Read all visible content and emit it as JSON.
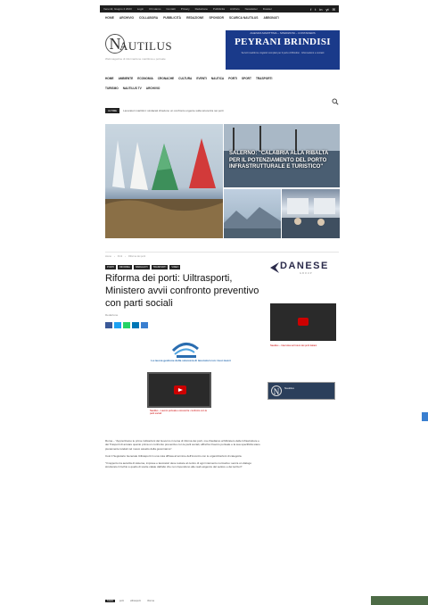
{
  "topbar": {
    "items": [
      "Venerdì, Giugno 2 2023",
      "Login",
      "Chi siamo",
      "Contatti",
      "Privacy",
      "Redazione",
      "Pubblicità",
      "Archivio",
      "Newsletter",
      "Dossier"
    ],
    "social": [
      "f",
      "t",
      "in",
      "yt",
      "✉"
    ]
  },
  "submenu": [
    "HOME",
    "ARCHIVIO",
    "COLLABORA",
    "PUBBLICITÀ",
    "REDAZIONE",
    "SPONSOR",
    "SCARICA NAUTILUS",
    "ABBONATI"
  ],
  "logo": {
    "word": "AUTILUS",
    "letter": "N",
    "tagline": "Webmagazine di informazione marittima e portuale"
  },
  "ad": {
    "top": "AGENZIA MARITTIMA – SPEDIZIONI – CONTAINERS",
    "main": "PEYRANI BRINDISI",
    "sub": "Servizi marittimi e logistici completi per il porto di Brindisi · Informazioni e contatti"
  },
  "mainnav": [
    "HOME",
    "AMBIENTE",
    "ECONOMIA",
    "CRONACHE",
    "CULTURA",
    "EVENTI",
    "NAUTICA",
    "PORTI",
    "SPORT",
    "TRASPORTI"
  ],
  "mainnav2": [
    "TURISMO",
    "NAUTILUS TV",
    "ARCHIVIO"
  ],
  "ticker": {
    "badge": "ULTIME",
    "text": "Lavoratori marittimi: sindacati chiedono un confronto urgente sulla sicurezza nei porti"
  },
  "hero": {
    "overlay": "Salerno: \"Calabria alla ribalta per il potenziamento del porto infrastrutturale e turistico\""
  },
  "crumbs": [
    "Home",
    "›",
    "Porti",
    "›",
    "Riforma dei porti"
  ],
  "categories": [
    "PORTI",
    "RIFORMA",
    "SINDACATI",
    "TRASPORTI",
    "VIDEO"
  ],
  "article": {
    "title": "Riforma dei porti: Uiltrasporti, Ministero avvii confronto preventivo con parti sociali",
    "author": "Redazione",
    "date": "",
    "brand_caption": "La nuova gestione della sicurezza di lavoratori con i tuoi mezzi",
    "video_caption": "Nautilus – Lavoro portuale e sicurezza: confronto con le parti sociali",
    "paragraphs": [
      "Roma – \"Apprezziamo le prime indicazioni del Governo in tema di riforma dei porti, ma chiediamo al Ministero delle Infrastrutture e dei Trasporti di avviare quanto prima un confronto preventivo con le parti sociali, affinché il lavoro portuale e la sua specificità siano pienamente tutelati nel nuovo assetto della governance\".",
      "Così il Segretario Generale Uiltrasporti in una nota diffusa al termine dell'incontro con le organizzazioni di categoria.",
      "\"Il rapporto tra autorità di sistema, imprese e lavoratori deve restare al centro di ogni intervento normativo: senza un dialogo strutturato il rischio è quello di scelte calate dall'alto che non rispondono alle reali esigenze del settore e dei territori\"."
    ]
  },
  "tags": [
    "TAGS",
    "porti",
    "uiltrasporti",
    "riforma"
  ],
  "sidebar": {
    "logo_word": "DANESE",
    "logo_sub": "GROUP",
    "video_caption": "Nautilus – Intervista sul futuro dei porti italiani",
    "banner_label": "Nautilus"
  },
  "colors": {
    "accent": "#c00000",
    "brand_blue": "#1a3a8a",
    "nav_dark": "#1e1e1e"
  }
}
